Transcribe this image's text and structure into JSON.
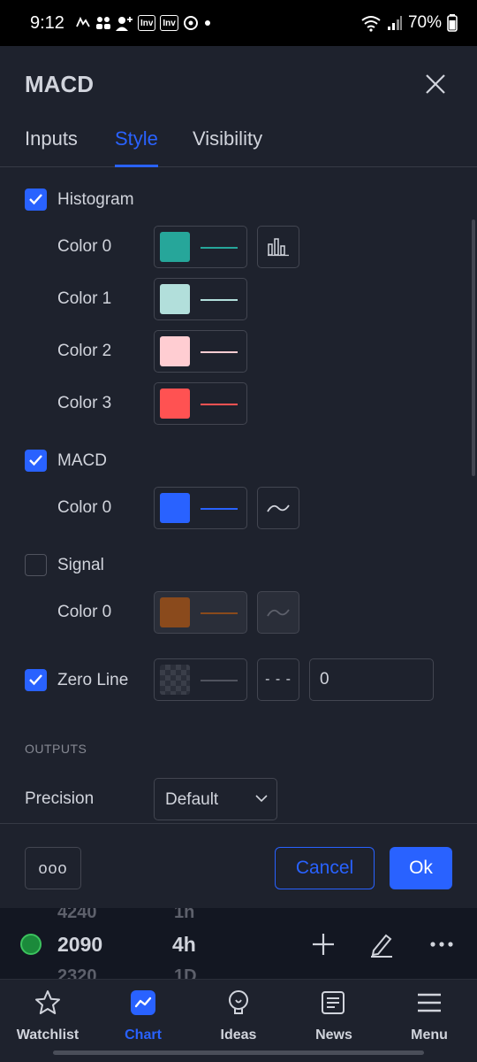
{
  "status_bar": {
    "time": "9:12",
    "notif_icons": [
      "news-icon",
      "people-icon",
      "add-person-icon",
      "inv-app-icon",
      "inv-app-icon",
      "sync-icon"
    ],
    "battery": "70%"
  },
  "dialog": {
    "title": "MACD",
    "tabs": [
      "Inputs",
      "Style",
      "Visibility"
    ],
    "active_tab": "Style"
  },
  "style": {
    "histogram": {
      "label": "Histogram",
      "checked": true,
      "colors": [
        {
          "label": "Color 0",
          "color": "#26a69a"
        },
        {
          "label": "Color 1",
          "color": "#b2dfdb"
        },
        {
          "label": "Color 2",
          "color": "#ffcdd2"
        },
        {
          "label": "Color 3",
          "color": "#ff5252"
        }
      ]
    },
    "macd": {
      "label": "MACD",
      "checked": true,
      "color_label": "Color 0",
      "color": "#2962ff"
    },
    "signal": {
      "label": "Signal",
      "checked": false,
      "color_label": "Color 0",
      "color": "#ff6d00"
    },
    "zero_line": {
      "label": "Zero Line",
      "checked": true,
      "line_style": "- - -",
      "value": "0",
      "color": "#787b86"
    },
    "outputs": {
      "section_label": "OUTPUTS",
      "precision_label": "Precision",
      "precision_value": "Default"
    }
  },
  "footer": {
    "more_label": "ooo",
    "cancel_label": "Cancel",
    "ok_label": "Ok"
  },
  "picker": {
    "above": {
      "value": "4240",
      "interval": "1h"
    },
    "current": {
      "value": "2090",
      "interval": "4h"
    },
    "below": {
      "value": "2320",
      "interval": "1D"
    }
  },
  "bottom_nav": [
    {
      "label": "Watchlist",
      "icon": "star-icon",
      "active": false
    },
    {
      "label": "Chart",
      "icon": "chart-icon",
      "active": true
    },
    {
      "label": "Ideas",
      "icon": "lightbulb-icon",
      "active": false
    },
    {
      "label": "News",
      "icon": "newspaper-icon",
      "active": false
    },
    {
      "label": "Menu",
      "icon": "hamburger-icon",
      "active": false
    }
  ],
  "colors": {
    "accent": "#2962ff",
    "background": "#1e222d",
    "border": "#434651"
  }
}
